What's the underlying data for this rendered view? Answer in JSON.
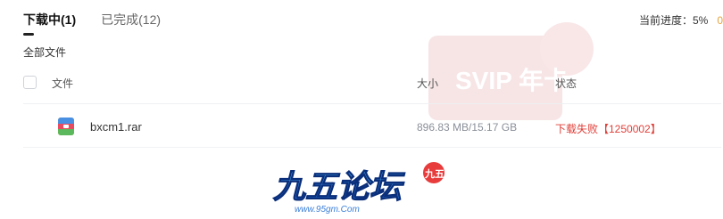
{
  "tabs": [
    {
      "label": "下载中(1)",
      "active": true
    },
    {
      "label": "已完成(12)",
      "active": false
    }
  ],
  "progress": {
    "label": "当前进度：",
    "value": "5%",
    "tail": "0"
  },
  "all_files_label": "全部文件",
  "columns": {
    "name": "文件",
    "size": "大小",
    "status": "状态"
  },
  "rows": [
    {
      "icon": "archive-icon",
      "name": "bxcm1.rar",
      "size": "896.83 MB/15.17 GB",
      "status": "下载失败【1250002】",
      "status_color": "#e0403a"
    }
  ],
  "watermark": {
    "promo_text": "SVIP 年卡",
    "forum_name": "九五论坛",
    "forum_url": "www.95gm.Com",
    "forum_stamp": "九五"
  }
}
